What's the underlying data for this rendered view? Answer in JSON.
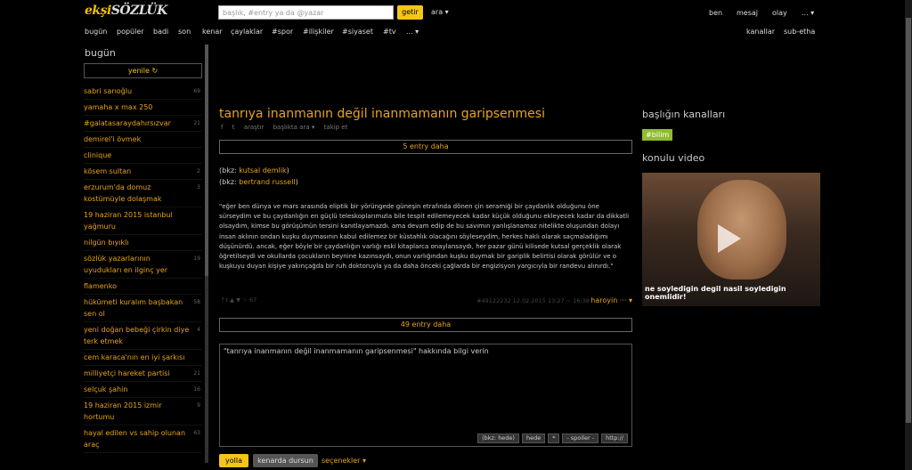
{
  "header": {
    "logo_prefix": "ekşi",
    "logo_main": "SÖZLÜK",
    "search_placeholder": "başlık, #entry ya da @yazar",
    "search_button": "getir",
    "ara_label": "ara ▾",
    "right_links": [
      "ben",
      "mesaj",
      "olay",
      "... ▾"
    ]
  },
  "nav": {
    "left": [
      "bugün",
      "popüler",
      "badi",
      "son",
      "kenar",
      "çaylaklar",
      "#spor",
      "#ilişkiler",
      "#siyaset",
      "#tv",
      "... ▾"
    ],
    "right": [
      "kanallar",
      "sub-etha"
    ]
  },
  "sidebar": {
    "title": "bugün",
    "refresh_label": "yenile ↻",
    "topics": [
      {
        "title": "sabri sarıoğlu",
        "count": "69"
      },
      {
        "title": "yamaha x max 250",
        "count": ""
      },
      {
        "title": "#galatasaraydahırsızvar",
        "count": "21"
      },
      {
        "title": "demirel'i övmek",
        "count": ""
      },
      {
        "title": "clinique",
        "count": ""
      },
      {
        "title": "kösem sultan",
        "count": "2"
      },
      {
        "title": "erzurum'da domuz kostümüyle dolaşmak",
        "count": "3"
      },
      {
        "title": "19 haziran 2015 istanbul yağmuru",
        "count": ""
      },
      {
        "title": "nilgün bıyıklı",
        "count": ""
      },
      {
        "title": "sözlük yazarlarının uyudukları en ilginç yer",
        "count": "19"
      },
      {
        "title": "flamenko",
        "count": ""
      },
      {
        "title": "hükümeti kuralım başbakan sen ol",
        "count": "58"
      },
      {
        "title": "yeni doğan bebeği çirkin diye terk etmek",
        "count": "4"
      },
      {
        "title": "cem karaca'nın en iyi şarkısı",
        "count": ""
      },
      {
        "title": "milliyetçi hareket partisi",
        "count": "21"
      },
      {
        "title": "selçuk şahin",
        "count": "16"
      },
      {
        "title": "19 haziran 2015 izmir hortumu",
        "count": "9"
      },
      {
        "title": "hayal edilen vs sahip olunan araç",
        "count": "63"
      }
    ]
  },
  "main": {
    "title": "tanrıya inanmanın değil inanmamanın garipsenmesi",
    "actions": [
      "f",
      "t",
      "araştır",
      "başlıkta ara ▾",
      "takip et"
    ],
    "more_before": "5 entry daha",
    "bkz_prefix": "(bkz:",
    "bkz_suffix": ")",
    "bkz1": "kutsal demlik",
    "bkz2": "bertrand russell",
    "entry_text": "\"eğer ben dünya ve mars arasında eliptik bir yörüngede güneşin etrafında dönen çin seramiği bir çaydanlık olduğunu öne sürseydim ve bu çaydanlığın en güçlü teleskoplarımızla bile tespit edilemeyecek kadar küçük olduğunu ekleyecek kadar da dikkatli olsaydım, kimse bu görüşümün tersini kanıtlayamazdı. ama devam edip de bu savımın yanlışlanamaz nitelikte oluşundan dolayı insan aklının ondan kuşku duymasının kabul edilemez bir küstahlık olacağını söyleseydim, herkes haklı olarak saçmaladığımı düşünürdü. ancak, eğer böyle bir çaydanlığın varlığı eski kitaplarca onaylansaydı, her pazar günü kilisede kutsal gerçeklik olarak öğretilseydi ve okullarda çocukların beynine kazınsaydı, onun varlığından kuşku duymak bir gariplik belirtisi olarak görülür ve o kuşkuyu duyan kişiye yakınçağda bir ruh doktoruyla ya da daha önceki çağlarda bir engizisyon yargıcıyla bir randevu alınırdı.\"",
    "footer_left": "f  t  ▲  ▼  ☆  67",
    "entry_meta": "#49122232 12.02.2015 13:27 ~ 16:38",
    "author": "haroyin ··· ▾",
    "more_after": "49 entry daha",
    "editor_text": "\"tanrıya inanmanın değil inanmamanın garipsenmesi\" hakkında bilgi verin",
    "tools": [
      "(bkz: hede)",
      "hede",
      "*",
      "- spoiler -",
      "http://"
    ],
    "submit": "yolla",
    "draft": "kenarda dursun",
    "options": "seçenekler ▾"
  },
  "right": {
    "channels_title": "başlığın kanalları",
    "channel_chip": "#bilim",
    "video_title": "konulu video",
    "video_caption": "ne soyledigin degil nasil soyledigin onemlidir!"
  }
}
